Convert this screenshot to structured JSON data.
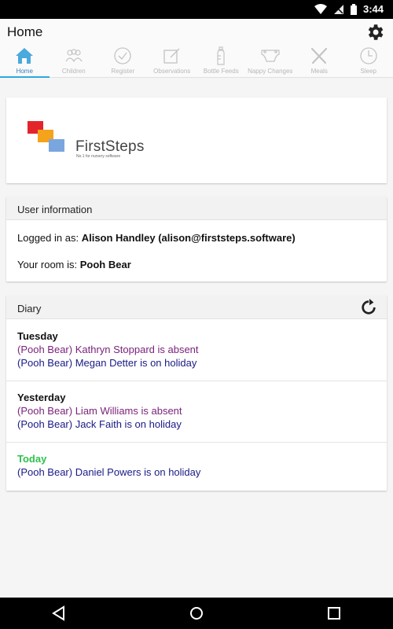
{
  "status_bar": {
    "time": "3:44"
  },
  "header": {
    "title": "Home"
  },
  "tabs": [
    {
      "label": "Home",
      "icon": "home-icon",
      "active": true
    },
    {
      "label": "Children",
      "icon": "children-icon"
    },
    {
      "label": "Register",
      "icon": "checkmark-circle-icon"
    },
    {
      "label": "Observations",
      "icon": "edit-icon"
    },
    {
      "label": "Bottle Feeds",
      "icon": "bottle-icon"
    },
    {
      "label": "Nappy Changes",
      "icon": "nappy-icon"
    },
    {
      "label": "Meals",
      "icon": "cutlery-icon"
    },
    {
      "label": "Sleep",
      "icon": "clock-icon"
    }
  ],
  "logo": {
    "brand": "FirstSteps",
    "tagline": "No.1 for nursery software"
  },
  "user_info": {
    "heading": "User information",
    "logged_in_label": "Logged in as:",
    "logged_in_value": "Alison Handley (alison@firststeps.software)",
    "room_label": "Your room is:",
    "room_value": "Pooh Bear"
  },
  "diary": {
    "heading": "Diary",
    "days": [
      {
        "day": "Tuesday",
        "items": [
          "(Pooh Bear) Kathryn Stoppard is absent",
          "(Pooh Bear) Megan Detter is on holiday"
        ]
      },
      {
        "day": "Yesterday",
        "items": [
          "(Pooh Bear) Liam Williams is absent",
          "(Pooh Bear) Jack Faith is on holiday"
        ]
      },
      {
        "day": "Today",
        "items": [
          "(Pooh Bear) Daniel Powers is on holiday"
        ]
      }
    ]
  },
  "colors": {
    "accent": "#2ea8dc",
    "absent_text": "#7a237a",
    "holiday_text": "#1a1a86",
    "today_heading": "#2fc24e",
    "logo_red": "#e3242b",
    "logo_orange": "#f5a31a",
    "logo_blue": "#7aa6e0"
  }
}
